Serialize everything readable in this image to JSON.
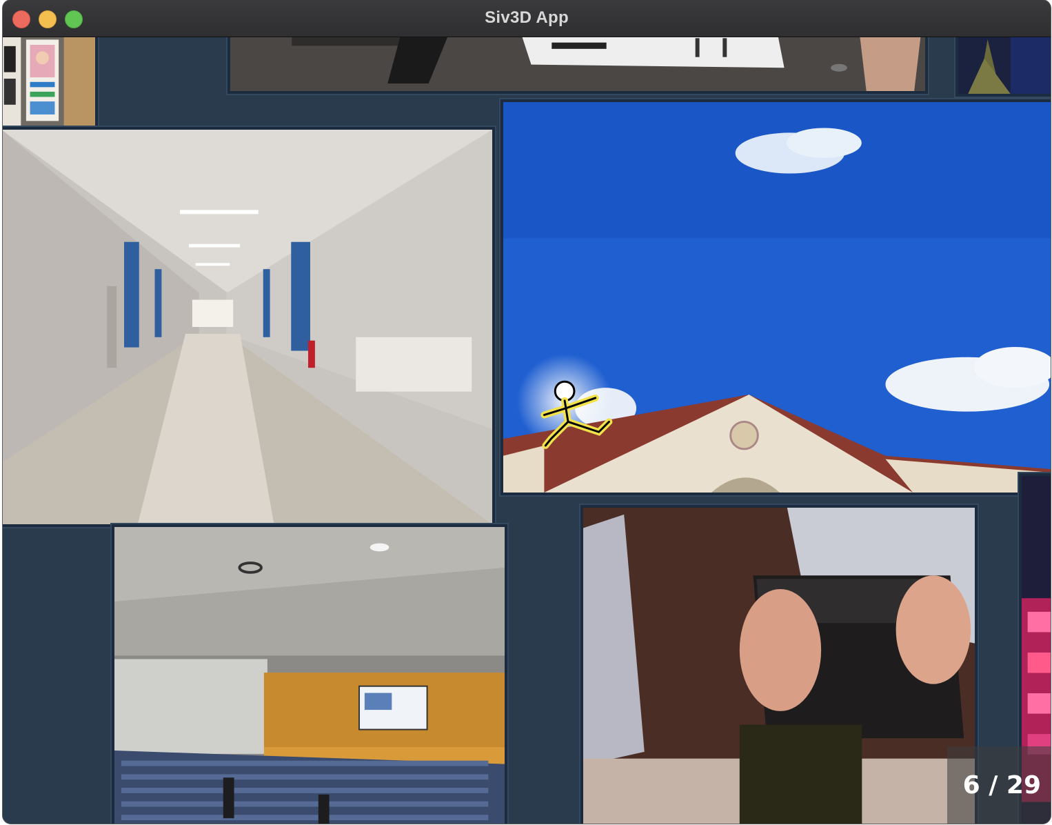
{
  "window": {
    "title": "Siv3D App"
  },
  "gallery": {
    "current": 6,
    "total": 29,
    "counter_text": "6 / 29",
    "photos": [
      {
        "subject": "storefront"
      },
      {
        "subject": "event-venue-table"
      },
      {
        "subject": "tree-night"
      },
      {
        "subject": "corridor"
      },
      {
        "subject": "sky-building-stickfigure"
      },
      {
        "subject": "lecture-hall"
      },
      {
        "subject": "hands-holding-device"
      },
      {
        "subject": "neon-sign"
      }
    ]
  },
  "colors": {
    "background": "#2a3b4d",
    "frame": "#1c2c3e",
    "sky": "#1f5fd0"
  }
}
